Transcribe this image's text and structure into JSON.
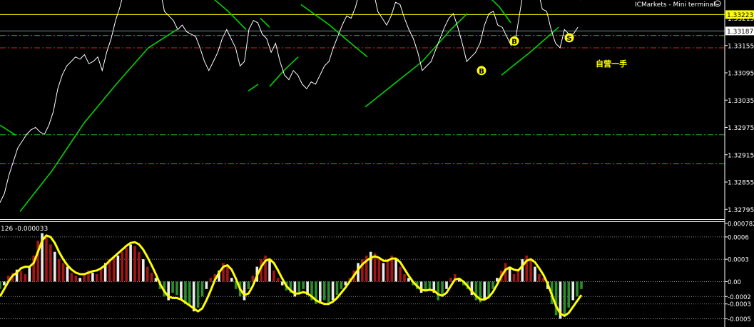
{
  "header": {
    "broker_title": "ICMarkets - Mini terminal",
    "terminal_icon": "smiley-icon"
  },
  "colors": {
    "background": "#000000",
    "price_line": "#ffffff",
    "trend_channel": "#00d400",
    "yellow_level": "#ffff00",
    "current_price_line": "#7f8c9a",
    "red_dash": "#e02020",
    "green_dash": "#21b821",
    "hist_positive": "#b01818",
    "hist_negative": "#2f9a2f",
    "hist_neutral": "#ffffff",
    "signal_line": "#ffff00",
    "axis_text": "#ffffff",
    "grid_dotted": "#b0b0b0",
    "marker_fill": "#ffff00",
    "marker_text": "#000000"
  },
  "chart_data": [
    {
      "type": "line",
      "name": "price-pane",
      "ylim": [
        1.32775,
        1.33255
      ],
      "y_ticks": [
        "1.32795",
        "1.32855",
        "1.32915",
        "1.32975",
        "1.33035",
        "1.33095",
        "1.33155",
        "1.33223",
        "1.33187"
      ],
      "tick_values": [
        1.32795,
        1.32855,
        1.32915,
        1.32975,
        1.33035,
        1.33095,
        1.33155,
        1.33217,
        1.33187
      ],
      "price_tag": "1.33223",
      "price_tag_value": 1.33223,
      "current_tag": "1.33187",
      "current_value": 1.33187,
      "hidden_tag": "1.33215",
      "horizontal_levels": [
        {
          "value": 1.33223,
          "style": "yellow-solid"
        },
        {
          "value": 1.33187,
          "style": "gray-solid"
        },
        {
          "value": 1.33177,
          "style": "green-dashdot"
        },
        {
          "value": 1.3315,
          "style": "red-dashdot"
        },
        {
          "value": 1.32959,
          "style": "green-dashdot"
        },
        {
          "value": 1.32895,
          "style": "green-dashdot"
        }
      ],
      "price_series": [
        1.3281,
        1.3283,
        1.3287,
        1.329,
        1.3293,
        1.32945,
        1.3296,
        1.3297,
        1.32975,
        1.32965,
        1.3296,
        1.3298,
        1.3301,
        1.3306,
        1.3309,
        1.3311,
        1.3312,
        1.3313,
        1.33125,
        1.33135,
        1.33115,
        1.3312,
        1.3313,
        1.331,
        1.3314,
        1.3317,
        1.3321,
        1.3324,
        1.3328,
        1.33315,
        1.333,
        1.33285,
        1.33305,
        1.333,
        1.3331,
        1.33285,
        1.3328,
        1.3323,
        1.3322,
        1.3321,
        1.3319,
        1.332,
        1.33185,
        1.3318,
        1.33175,
        1.3315,
        1.3312,
        1.331,
        1.3312,
        1.3314,
        1.3317,
        1.3319,
        1.3317,
        1.3315,
        1.3311,
        1.3312,
        1.3319,
        1.3321,
        1.33205,
        1.3318,
        1.3317,
        1.3314,
        1.3316,
        1.3312,
        1.3309,
        1.3308,
        1.331,
        1.3309,
        1.3307,
        1.3306,
        1.33075,
        1.3307,
        1.3309,
        1.3311,
        1.3312,
        1.3315,
        1.33175,
        1.332,
        1.3322,
        1.33215,
        1.3324,
        1.3328,
        1.3332,
        1.3329,
        1.33275,
        1.3323,
        1.33215,
        1.332,
        1.3322,
        1.3325,
        1.33245,
        1.33215,
        1.3319,
        1.3317,
        1.3314,
        1.331,
        1.3311,
        1.3312,
        1.33145,
        1.3317,
        1.33195,
        1.33215,
        1.33225,
        1.33195,
        1.3316,
        1.3312,
        1.3313,
        1.3314,
        1.3316,
        1.332,
        1.33225,
        1.3323,
        1.332,
        1.33195,
        1.33175,
        1.33155,
        1.3317,
        1.3323,
        1.3329,
        1.3332,
        1.333,
        1.3328,
        1.33235,
        1.3323,
        1.3319,
        1.3316,
        1.3315,
        1.3319,
        1.3318,
        1.3318,
        1.33195
      ],
      "trend_channel_segments": [
        [
          [
            0,
            1.3298
          ],
          [
            22,
            1.32958
          ]
        ],
        [
          [
            28,
            1.3279
          ],
          [
            73,
            1.3288
          ],
          [
            118,
            1.32985
          ],
          [
            163,
            1.3307
          ],
          [
            208,
            1.3315
          ],
          [
            248,
            1.3319
          ]
        ],
        [
          [
            250,
            1.33315
          ],
          [
            290,
            1.3327
          ],
          [
            320,
            1.3323
          ],
          [
            345,
            1.3319
          ]
        ],
        [
          [
            348,
            1.33055
          ],
          [
            362,
            1.3307
          ]
        ],
        [
          [
            365,
            1.33215
          ],
          [
            378,
            1.33195
          ]
        ],
        [
          [
            378,
            1.33065
          ],
          [
            398,
            1.331
          ],
          [
            418,
            1.3313
          ]
        ],
        [
          [
            422,
            1.33245
          ],
          [
            462,
            1.332
          ],
          [
            488,
            1.33165
          ],
          [
            515,
            1.3313
          ]
        ],
        [
          [
            512,
            1.3302
          ],
          [
            552,
            1.3307
          ],
          [
            592,
            1.3312
          ],
          [
            632,
            1.3319
          ],
          [
            655,
            1.33225
          ]
        ],
        [
          [
            630,
            1.3331
          ],
          [
            667,
            1.3329
          ],
          [
            700,
            1.3324
          ],
          [
            716,
            1.33205
          ]
        ],
        [
          [
            703,
            1.3309
          ],
          [
            743,
            1.3314
          ],
          [
            783,
            1.33195
          ]
        ],
        [
          [
            776,
            1.33315
          ],
          [
            800,
            1.3328
          ],
          [
            815,
            1.33255
          ]
        ]
      ],
      "markers": [
        {
          "label": "B",
          "x": 675,
          "value": 1.331
        },
        {
          "label": "B",
          "x": 721,
          "value": 1.33165
        },
        {
          "label": "S",
          "x": 798,
          "value": 1.33172
        }
      ],
      "annotation": "自营一手"
    },
    {
      "type": "bar",
      "name": "oscillator-pane",
      "indicator_label": "126 -0.000033",
      "ylim": [
        -0.0006,
        0.0008
      ],
      "y_ticks": [
        "0.000782",
        "0.0006",
        "0.0003",
        "0.00",
        "-0.0002",
        "-0.0003",
        "-0.0005"
      ],
      "tick_values": [
        0.000782,
        0.0006,
        0.0003,
        0.0,
        -0.0002,
        -0.0003,
        -0.0005
      ],
      "dotted_levels": [
        0.0006,
        0.0003,
        0.0,
        -0.0002,
        -0.0003,
        -0.0005
      ],
      "histogram": [
        -0.0001,
        -5e-05,
        8e-05,
        0.00012,
        0.00016,
        0.00014,
        0.0001,
        0.0002,
        0.00035,
        0.00055,
        0.00065,
        0.0006,
        0.0005,
        0.0004,
        0.0003,
        0.00025,
        0.0002,
        0.00012,
        8e-05,
        5e-05,
        0.0001,
        0.00015,
        0.00012,
        0.0001,
        0.00018,
        0.00025,
        0.0003,
        0.00032,
        0.00035,
        0.0004,
        0.00045,
        0.0005,
        0.00048,
        0.0004,
        0.0003,
        0.0002,
        0.00012,
        5e-05,
        -0.0001,
        -0.0002,
        -0.00025,
        -0.00015,
        -0.00018,
        -0.00025,
        -0.0003,
        -0.00032,
        -0.0004,
        -0.00035,
        -0.0002,
        -0.0001,
        5e-05,
        0.0001,
        0.00015,
        0.00025,
        0.0002,
        5e-05,
        -0.0001,
        -0.0002,
        -0.00025,
        -0.0001,
        8e-05,
        0.0002,
        0.0003,
        0.00035,
        0.0003,
        0.00015,
        5e-05,
        -5e-05,
        -0.00012,
        -0.00015,
        -0.0002,
        -0.00015,
        -0.0001,
        -0.00018,
        -0.00025,
        -0.0003,
        -0.00028,
        -0.00025,
        -0.0003,
        -0.00025,
        -0.00018,
        -0.0001,
        -5e-05,
        5e-05,
        0.00015,
        0.00025,
        0.0003,
        0.00035,
        0.0004,
        0.00038,
        0.0003,
        0.00025,
        0.0003,
        0.00035,
        0.0003,
        0.0002,
        0.0001,
        5e-05,
        -5e-05,
        -0.0001,
        -0.00015,
        -0.00012,
        -0.0001,
        -0.00015,
        -0.00025,
        -0.0002,
        -0.0001,
        5e-05,
        0.0001,
        5e-05,
        -5e-05,
        -0.0001,
        -0.00018,
        -0.00025,
        -0.00028,
        -0.00025,
        -0.0002,
        -0.0001,
        5e-05,
        0.00015,
        0.00025,
        0.0002,
        0.0001,
        0.00015,
        0.0003,
        0.00035,
        0.0003,
        0.0002,
        0.0001,
        5e-05,
        -0.0001,
        -0.0003,
        -0.00045,
        -0.0005,
        -0.00045,
        -0.00035,
        -0.00025,
        -0.0002,
        -0.0001
      ],
      "signal": [
        -0.0002,
        -0.0001,
        0.0,
        8e-05,
        0.00012,
        0.00018,
        0.0002,
        0.0002,
        0.00025,
        0.0004,
        0.00055,
        0.00062,
        0.0006,
        0.00052,
        0.0004,
        0.0003,
        0.00022,
        0.00016,
        0.00012,
        0.0001,
        0.0001,
        0.00012,
        0.00014,
        0.00015,
        0.00018,
        0.00022,
        0.00028,
        0.00033,
        0.00038,
        0.00043,
        0.00048,
        0.00052,
        0.00053,
        0.0005,
        0.00043,
        0.00033,
        0.00022,
        0.0001,
        -3e-05,
        -0.00013,
        -0.0002,
        -0.00022,
        -0.00022,
        -0.00024,
        -0.00028,
        -0.00032,
        -0.00036,
        -0.0004,
        -0.00036,
        -0.00025,
        -0.00012,
        2e-05,
        0.00012,
        0.0002,
        0.00022,
        0.00016,
        4e-05,
        -0.0001,
        -0.00018,
        -0.00016,
        -6e-05,
        8e-05,
        0.0002,
        0.00028,
        0.0003,
        0.00025,
        0.00015,
        4e-05,
        -6e-05,
        -0.00012,
        -0.00016,
        -0.00016,
        -0.00014,
        -0.00016,
        -0.0002,
        -0.00025,
        -0.00028,
        -0.0003,
        -0.0003,
        -0.00027,
        -0.00022,
        -0.00015,
        -8e-05,
        0.0,
        8e-05,
        0.00016,
        0.00023,
        0.00028,
        0.00032,
        0.00034,
        0.00032,
        0.00028,
        0.00028,
        0.00031,
        0.00031,
        0.00026,
        0.00017,
        8e-05,
        0.0,
        -6e-05,
        -0.00011,
        -0.00012,
        -0.00011,
        -0.00012,
        -0.00017,
        -0.00019,
        -0.00015,
        -6e-05,
        3e-05,
        4e-05,
        0.0,
        -6e-05,
        -0.00013,
        -0.00019,
        -0.00024,
        -0.00024,
        -0.00021,
        -0.00014,
        -4e-05,
        7e-05,
        0.00016,
        0.00019,
        0.00016,
        0.00015,
        0.00021,
        0.00028,
        0.0003,
        0.00026,
        0.00018,
        9e-05,
        -3e-05,
        -0.00018,
        -0.00033,
        -0.00043,
        -0.00046,
        -0.00042,
        -0.00034,
        -0.00026,
        -0.00018
      ]
    }
  ]
}
